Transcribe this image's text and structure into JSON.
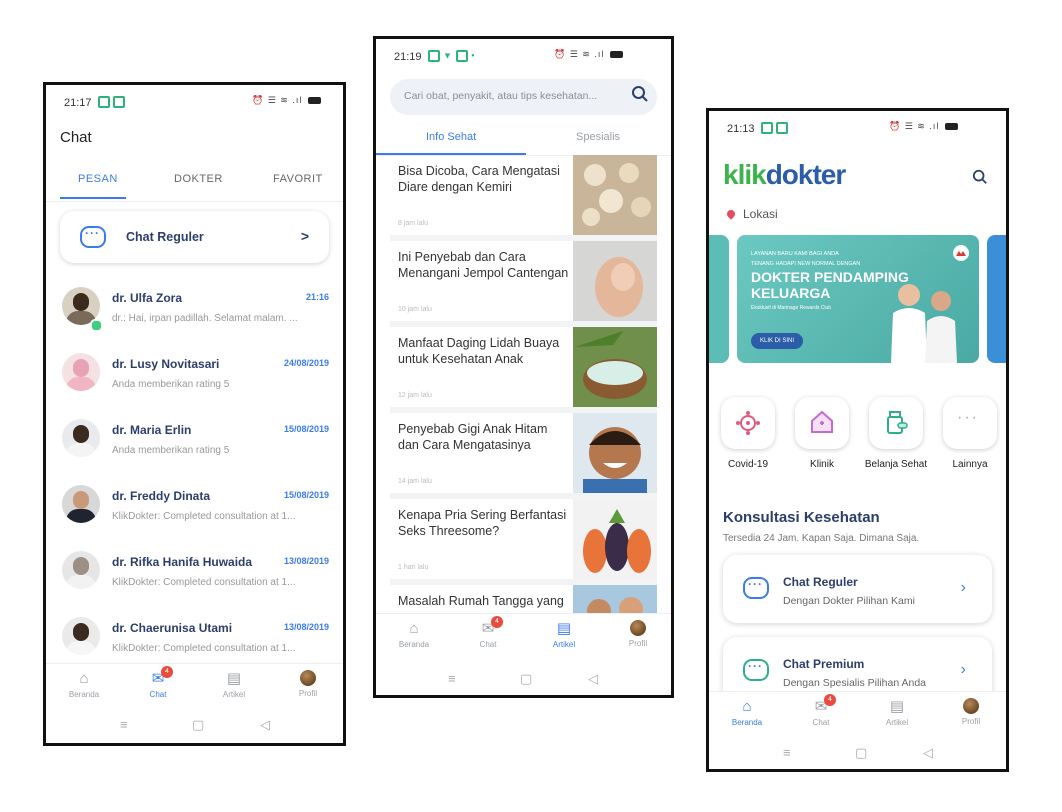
{
  "screen_chat": {
    "status": {
      "time": "21:17"
    },
    "title": "Chat",
    "tabs": [
      "PESAN",
      "DOKTER",
      "FAVORIT"
    ],
    "regular_chat": {
      "label": "Chat Reguler",
      "arrow": ">"
    },
    "chats": [
      {
        "name": "dr. Ulfa Zora",
        "time": "21:16",
        "message": "dr.: Hai, irpan padillah. Selamat malam. ..."
      },
      {
        "name": "dr. Lusy Novitasari",
        "time": "24/08/2019",
        "message": "Anda memberikan rating 5"
      },
      {
        "name": "dr. Maria Erlin",
        "time": "15/08/2019",
        "message": "Anda memberikan rating 5"
      },
      {
        "name": "dr. Freddy Dinata",
        "time": "15/08/2019",
        "message": "KlikDokter: Completed consultation at 1..."
      },
      {
        "name": "dr. Rifka Hanifa Huwaida",
        "time": "13/08/2019",
        "message": "KlikDokter: Completed consultation at 1..."
      },
      {
        "name": "dr. Chaerunisa Utami",
        "time": "13/08/2019",
        "message": "KlikDokter: Completed consultation at 1..."
      }
    ],
    "nav": {
      "home": "Beranda",
      "chat": "Chat",
      "article": "Artikel",
      "profile": "Profil",
      "chat_badge": "4"
    }
  },
  "screen_articles": {
    "status": {
      "time": "21:19"
    },
    "search_placeholder": "Cari obat, penyakit, atau tips kesehatan...",
    "tabs": [
      "Info Sehat",
      "Spesialis"
    ],
    "articles": [
      {
        "title": "Bisa Dicoba, Cara Mengatasi Diare dengan Kemiri",
        "time": "8 jam lalu"
      },
      {
        "title": "Ini Penyebab dan Cara Menangani Jempol Cantengan",
        "time": "10 jam lalu"
      },
      {
        "title": "Manfaat Daging Lidah Buaya untuk Kesehatan Anak",
        "time": "12 jam lalu"
      },
      {
        "title": "Penyebab Gigi Anak Hitam dan Cara Mengatasinya",
        "time": "14 jam lalu"
      },
      {
        "title": "Kenapa Pria Sering Berfantasi Seks Threesome?",
        "time": "1 hari lalu"
      },
      {
        "title": "Masalah Rumah Tangga yang",
        "time": ""
      }
    ],
    "nav": {
      "home": "Beranda",
      "chat": "Chat",
      "article": "Artikel",
      "profile": "Profil",
      "chat_badge": "4"
    }
  },
  "screen_home": {
    "status": {
      "time": "21:13"
    },
    "logo": {
      "part1": "klik",
      "part2": "dokter"
    },
    "location": "Lokasi",
    "banner": {
      "kicker": "LAYANAN BARU KAMI BAGI ANDA",
      "line": "TENANG HADAPI NEW NORMAL DENGAN",
      "headline1": "DOKTER PENDAMPING",
      "headline2": "KELUARGA",
      "small": "Eksklusif di Marinage Rewards Club",
      "cta": "KLIK DI SINI"
    },
    "quick_menu": [
      "Covid-19",
      "Klinik",
      "Belanja Sehat",
      "Lainnya"
    ],
    "section": {
      "title": "Konsultasi Kesehatan",
      "subtitle": "Tersedia 24 Jam. Kapan Saja. Dimana Saja."
    },
    "services": [
      {
        "title": "Chat Reguler",
        "subtitle": "Dengan Dokter Pilihan Kami"
      },
      {
        "title": "Chat Premium",
        "subtitle": "Dengan Spesialis Pilihan Anda"
      }
    ],
    "nav": {
      "home": "Beranda",
      "chat": "Chat",
      "article": "Artikel",
      "profile": "Profil",
      "chat_badge": "4"
    }
  },
  "colors": {
    "accent": "#3b7bf0",
    "brand_green": "#3cb44b",
    "brand_blue": "#2c5da8",
    "badge": "#e74c3c"
  }
}
